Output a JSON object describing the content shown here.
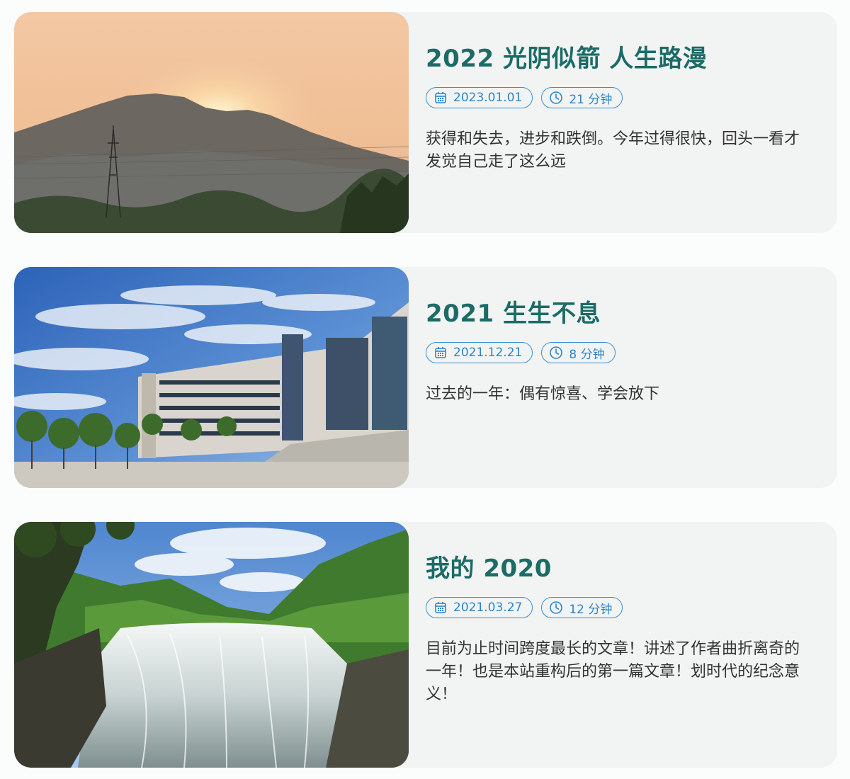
{
  "posts": [
    {
      "title": "2022 光阴似箭 人生路漫",
      "date": "2023.01.01",
      "read_time": "21 分钟",
      "excerpt": "获得和失去，进步和跌倒。今年过得很快，回头一看才发觉自己走了这么远",
      "image": "mountain-sunset-photo"
    },
    {
      "title": "2021 生生不息",
      "date": "2021.12.21",
      "read_time": "8 分钟",
      "excerpt": "过去的一年：偶有惊喜、学会放下",
      "image": "campus-building-photo"
    },
    {
      "title": "我的 2020",
      "date": "2021.03.27",
      "read_time": "12 分钟",
      "excerpt": "目前为止时间跨度最长的文章！讲述了作者曲折离奇的一年！也是本站重构后的第一篇文章！划时代的纪念意义！",
      "image": "waterfall-photo"
    }
  ],
  "icons": {
    "date": "calendar-icon",
    "read_time": "clock-icon"
  },
  "colors": {
    "title": "#1c6b66",
    "pill": "#2d85cc",
    "card_bg": "#f1f4f3"
  }
}
